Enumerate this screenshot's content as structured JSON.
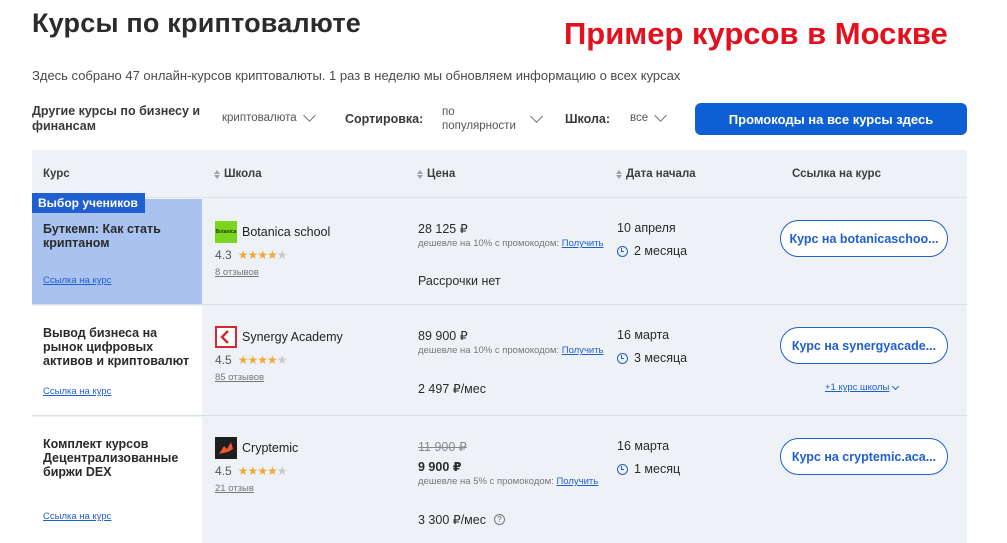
{
  "page": {
    "title": "Курсы по криптовалюте",
    "promo_title": "Пример курсов в Москве",
    "subtitle": "Здесь собрано 47 онлайн-курсов криптовалюты. 1 раз в неделю мы обновляем информацию о всех курсах"
  },
  "filters": {
    "other_label": "Другие курсы по бизнесу и финансам",
    "category_value": "криптовалюта",
    "sort_label": "Сортировка:",
    "sort_value": "по популярности",
    "school_label": "Школа:",
    "school_value": "все",
    "promo_button": "Промокоды на все курсы здесь"
  },
  "table": {
    "headers": {
      "course": "Курс",
      "school": "Школа",
      "price": "Цена",
      "start_date": "Дата начала",
      "link": "Ссылка на курс"
    },
    "rows": [
      {
        "badge": "Выбор учеников",
        "course_name": "Буткемп: Как стать криптаном",
        "course_link": "Ссылка на курс",
        "school_name": "Botanica school",
        "logo_text": "Botanica",
        "rating": "4.3",
        "stars_fraction": 0.86,
        "reviews": "8 отзывов",
        "old_price": "",
        "price": "28 125 ₽",
        "discount_text": "дешевле на 10% с промокодом:",
        "discount_link": "Получить",
        "installment": "Рассрочки нет",
        "start_date": "10 апреля",
        "duration": "2 месяца",
        "button": "Курс на botanicaschoo...",
        "more_link": ""
      },
      {
        "badge": "",
        "course_name": "Вывод бизнеса на рынок цифровых активов и криптовалют",
        "course_link": "Ссылка на курс",
        "school_name": "Synergy Academy",
        "logo_text": "",
        "rating": "4.5",
        "stars_fraction": 0.9,
        "reviews": "85 отзывов",
        "old_price": "",
        "price": "89 900 ₽",
        "discount_text": "дешевле на 10% с промокодом:",
        "discount_link": "Получить",
        "installment": "2 497 ₽/мес",
        "start_date": "16 марта",
        "duration": "3 месяца",
        "button": "Курс на synergyacade...",
        "more_link": "+1 курс школы"
      },
      {
        "badge": "",
        "course_name": "Комплект курсов Децентрализованные биржи DEX",
        "course_link": "Ссылка на курс",
        "school_name": "Cryptemic",
        "logo_text": "",
        "rating": "4.5",
        "stars_fraction": 0.9,
        "reviews": "21 отзыв",
        "old_price": "11 900 ₽",
        "price": "9 900 ₽",
        "discount_text": "дешевле на 5% с промокодом:",
        "discount_link": "Получить",
        "installment": "3 300 ₽/мес",
        "start_date": "16 марта",
        "duration": "1 месяц",
        "button": "Курс на cryptemic.aca...",
        "more_link": ""
      }
    ]
  },
  "colors": {
    "accent": "#1f5fcf",
    "promo_button": "#0d5fd3",
    "promo_title": "#e3101e",
    "selected_row": "#a9c2ef",
    "star": "#f2a83a"
  },
  "icons": [
    "chevron-down-icon",
    "sort-icon",
    "star-icon",
    "clock-icon",
    "question-icon"
  ]
}
